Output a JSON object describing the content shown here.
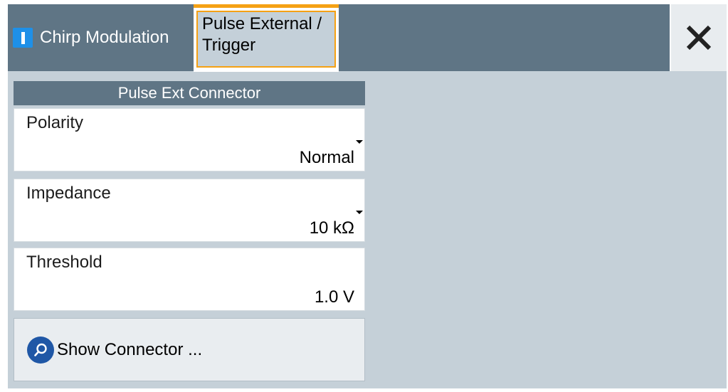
{
  "tabs": [
    {
      "label": "Chirp Modulation",
      "state_icon": "state-on-icon"
    },
    {
      "label_line1": "Pulse External /",
      "label_line2": "Trigger",
      "active": true
    }
  ],
  "close_icon": "close-icon",
  "section": {
    "title": "Pulse Ext Connector"
  },
  "fields": {
    "polarity": {
      "label": "Polarity",
      "value": "Normal"
    },
    "impedance": {
      "label": "Impedance",
      "value": "10 kΩ"
    },
    "threshold": {
      "label": "Threshold",
      "value": "1.0 V"
    }
  },
  "show_connector": {
    "label": "Show Connector ...",
    "icon": "search-icon"
  },
  "colors": {
    "header_bg": "#5f7585",
    "panel_bg": "#c5d0d8",
    "active_tab_border": "#f5a114",
    "state_icon_blue": "#1e90e8",
    "search_icon_blue": "#1f57a6"
  }
}
